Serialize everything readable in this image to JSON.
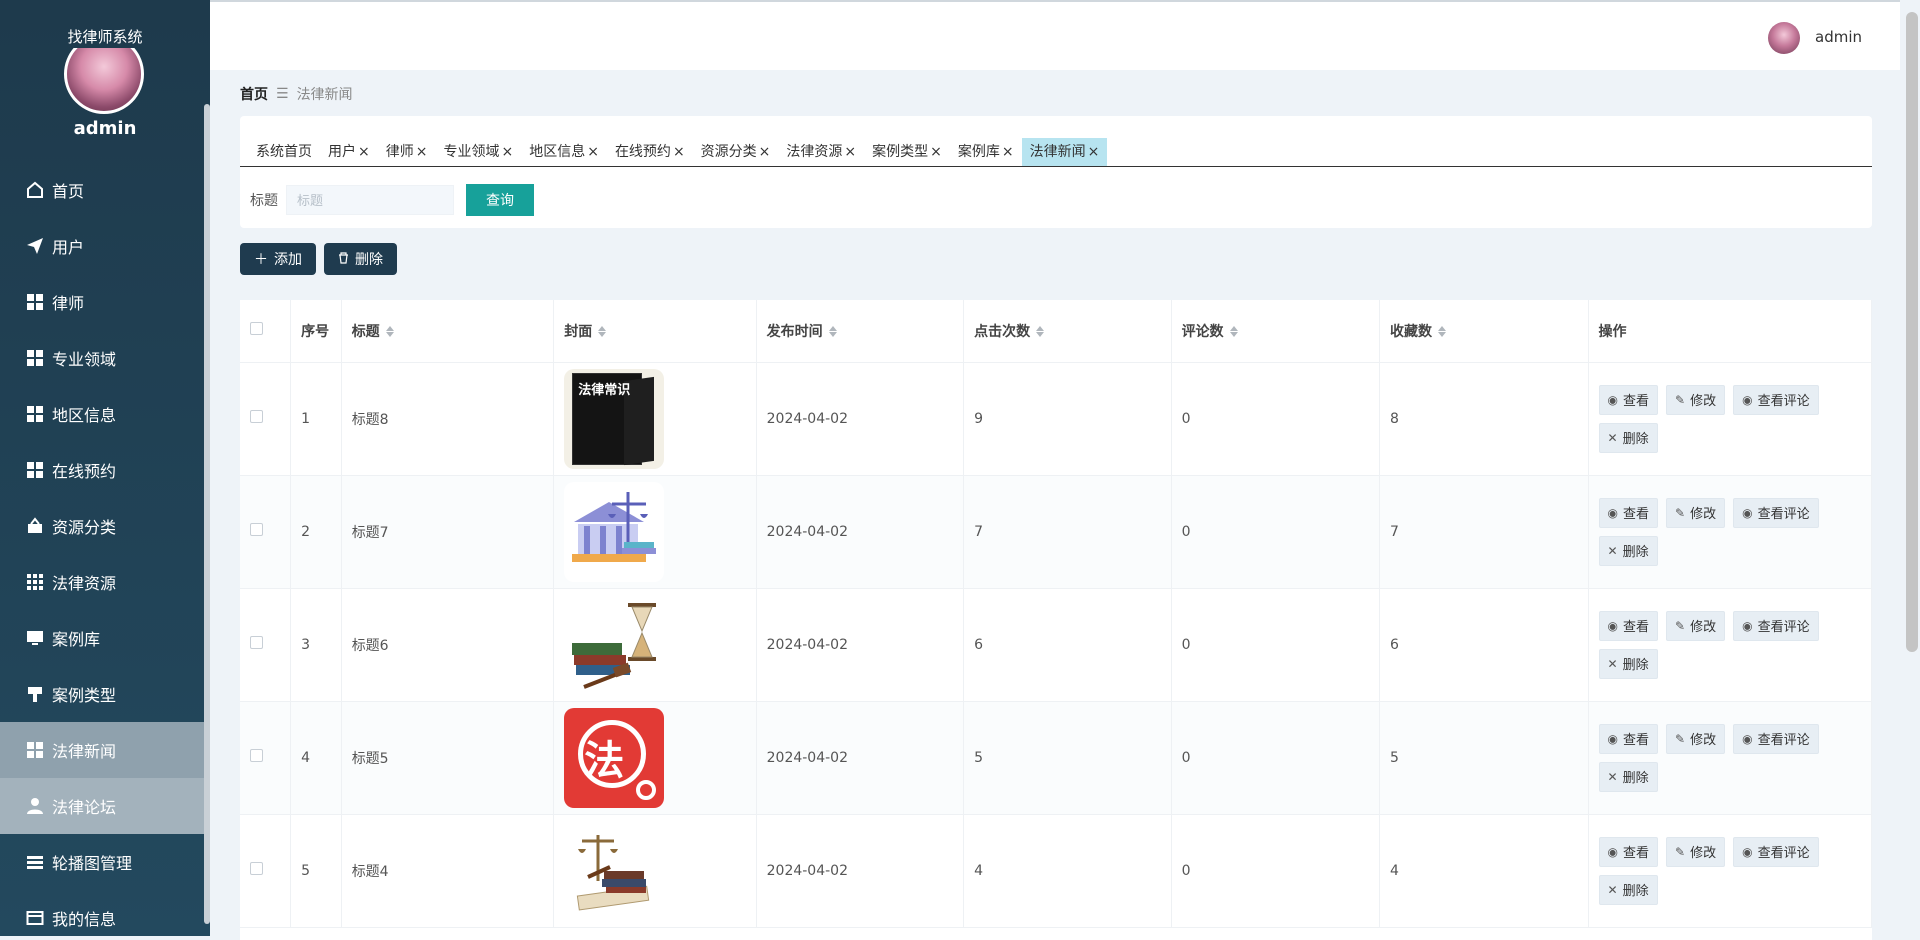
{
  "app": {
    "title": "找律师系统",
    "user": "admin"
  },
  "sidebar": {
    "items": [
      {
        "label": "首页",
        "icon": "home-icon"
      },
      {
        "label": "用户",
        "icon": "paper-plane-icon"
      },
      {
        "label": "律师",
        "icon": "grid-icon"
      },
      {
        "label": "专业领域",
        "icon": "grid-icon"
      },
      {
        "label": "地区信息",
        "icon": "grid-icon"
      },
      {
        "label": "在线预约",
        "icon": "grid-icon"
      },
      {
        "label": "资源分类",
        "icon": "box-icon"
      },
      {
        "label": "法律资源",
        "icon": "apps-icon"
      },
      {
        "label": "案例库",
        "icon": "monitor-icon"
      },
      {
        "label": "案例类型",
        "icon": "brush-icon"
      },
      {
        "label": "法律新闻",
        "icon": "grid-icon"
      },
      {
        "label": "法律论坛",
        "icon": "user-icon"
      },
      {
        "label": "轮播图管理",
        "icon": "list-icon"
      },
      {
        "label": "我的信息",
        "icon": "card-icon"
      }
    ]
  },
  "header": {
    "user": "admin"
  },
  "breadcrumb": {
    "home": "首页",
    "current": "法律新闻"
  },
  "tabs": [
    {
      "label": "系统首页",
      "closable": false
    },
    {
      "label": "用户",
      "closable": true
    },
    {
      "label": "律师",
      "closable": true
    },
    {
      "label": "专业领域",
      "closable": true
    },
    {
      "label": "地区信息",
      "closable": true
    },
    {
      "label": "在线预约",
      "closable": true
    },
    {
      "label": "资源分类",
      "closable": true
    },
    {
      "label": "法律资源",
      "closable": true
    },
    {
      "label": "案例类型",
      "closable": true
    },
    {
      "label": "案例库",
      "closable": true
    },
    {
      "label": "法律新闻",
      "closable": true
    }
  ],
  "search": {
    "label": "标题",
    "placeholder": "标题",
    "button": "查询"
  },
  "actions": {
    "add": "添加",
    "delete": "删除"
  },
  "table": {
    "headers": [
      "序号",
      "标题",
      "封面",
      "发布时间",
      "点击次数",
      "评论数",
      "收藏数",
      "操作"
    ],
    "rows": [
      {
        "index": "1",
        "title": "标题8",
        "date": "2024-04-02",
        "clicks": "9",
        "comments": "0",
        "favs": "8",
        "cover_text": "法律常识"
      },
      {
        "index": "2",
        "title": "标题7",
        "date": "2024-04-02",
        "clicks": "7",
        "comments": "0",
        "favs": "7"
      },
      {
        "index": "3",
        "title": "标题6",
        "date": "2024-04-02",
        "clicks": "6",
        "comments": "0",
        "favs": "6"
      },
      {
        "index": "4",
        "title": "标题5",
        "date": "2024-04-02",
        "clicks": "5",
        "comments": "0",
        "favs": "5",
        "cover_text": "法"
      },
      {
        "index": "5",
        "title": "标题4",
        "date": "2024-04-02",
        "clicks": "4",
        "comments": "0",
        "favs": "4"
      }
    ],
    "ops": {
      "view": "查看",
      "edit": "修改",
      "view_comments": "查看评论",
      "delete": "删除"
    }
  }
}
